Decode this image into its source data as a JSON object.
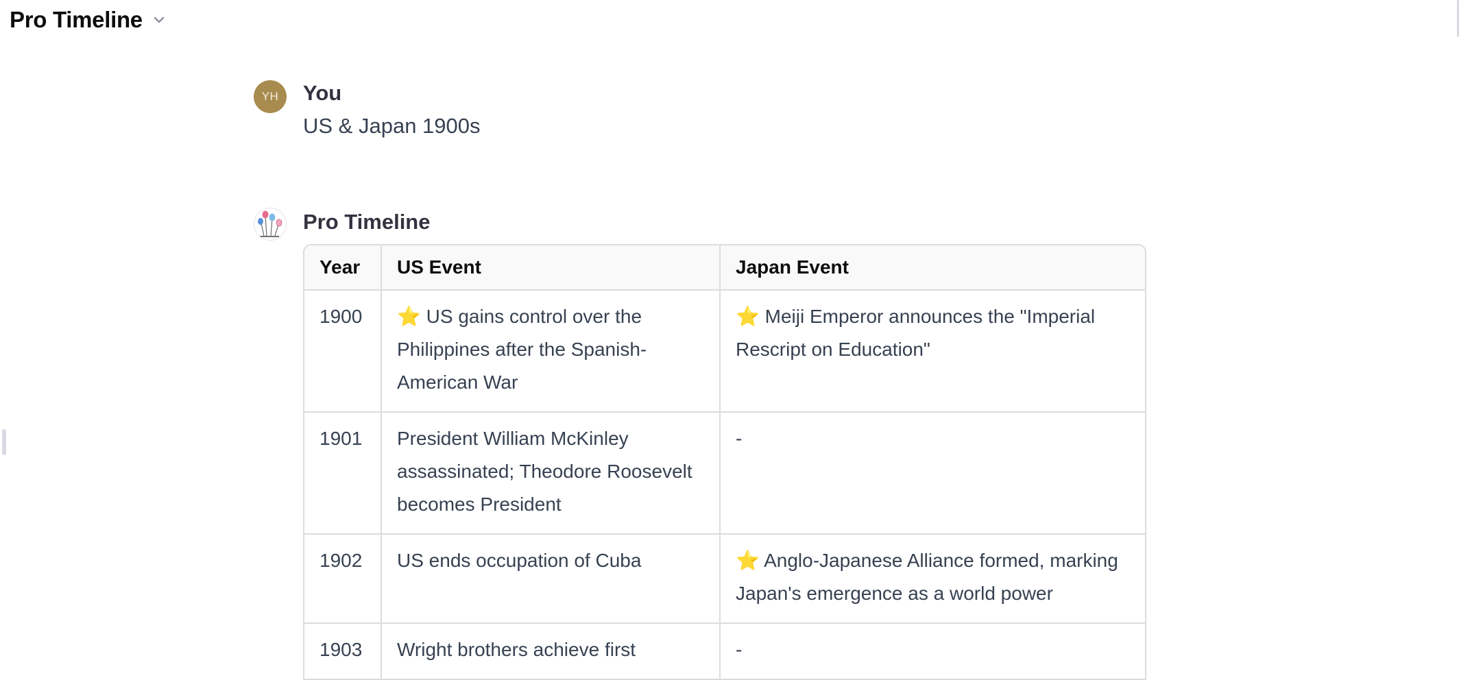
{
  "header": {
    "title": "Pro Timeline",
    "chevron_icon": "chevron-down-icon"
  },
  "user_message": {
    "avatar_initials": "YH",
    "author": "You",
    "text": "US & Japan 1900s"
  },
  "assistant_message": {
    "author": "Pro Timeline",
    "avatar_icon": "balloons-icon"
  },
  "table": {
    "headers": [
      "Year",
      "US Event",
      "Japan Event"
    ],
    "rows": [
      {
        "year": "1900",
        "us": "⭐ US gains control over the Philippines after the Spanish-American War",
        "japan": "⭐ Meiji Emperor announces the \"Imperial Rescript on Education\""
      },
      {
        "year": "1901",
        "us": "President William McKinley assassinated; Theodore Roosevelt becomes President",
        "japan": "-"
      },
      {
        "year": "1902",
        "us": "US ends occupation of Cuba",
        "japan": "⭐ Anglo-Japanese Alliance formed, marking Japan's emergence as a world power"
      },
      {
        "year": "1903",
        "us": "Wright brothers achieve first",
        "japan": "-"
      }
    ]
  },
  "colors": {
    "user_avatar_bg": "#a88b4e",
    "star": "#f4b400",
    "border": "#dcdce0",
    "header_bg": "#f9f9f9"
  }
}
